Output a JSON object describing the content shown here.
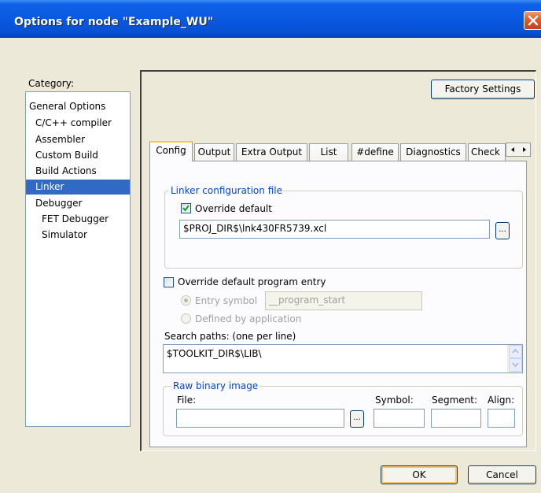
{
  "window": {
    "title": "Options for node \"Example_WU\""
  },
  "category": {
    "label": "Category:",
    "items": [
      {
        "label": "General Options"
      },
      {
        "label": "C/C++ compiler"
      },
      {
        "label": "Assembler"
      },
      {
        "label": "Custom Build"
      },
      {
        "label": "Build Actions"
      },
      {
        "label": "Linker"
      },
      {
        "label": "Debugger"
      },
      {
        "label": "FET Debugger"
      },
      {
        "label": "Simulator"
      }
    ],
    "selected": "Linker"
  },
  "factory_settings_label": "Factory Settings",
  "tabs": [
    {
      "label": "Config"
    },
    {
      "label": "Output"
    },
    {
      "label": "Extra Output"
    },
    {
      "label": "List"
    },
    {
      "label": "#define"
    },
    {
      "label": "Diagnostics"
    },
    {
      "label": "Check"
    }
  ],
  "active_tab": "Config",
  "linker_config": {
    "group_title": "Linker configuration file",
    "override_label": "Override default",
    "override_checked": true,
    "path_value": "$PROJ_DIR$\\lnk430FR5739.xcl",
    "browse_label": "..."
  },
  "program_entry": {
    "override_label": "Override default program entry",
    "override_checked": false,
    "entry_symbol_label": "Entry symbol",
    "entry_symbol_value": "__program_start",
    "defined_by_app_label": "Defined by application"
  },
  "search_paths": {
    "label": "Search paths:  (one per line)",
    "value": "$TOOLKIT_DIR$\\LIB\\"
  },
  "raw_binary": {
    "group_title": "Raw binary image",
    "file_label": "File:",
    "file_value": "",
    "browse_label": "...",
    "symbol_label": "Symbol:",
    "symbol_value": "",
    "segment_label": "Segment:",
    "segment_value": "",
    "align_label": "Align:",
    "align_value": ""
  },
  "buttons": {
    "ok": "OK",
    "cancel": "Cancel"
  },
  "colors": {
    "selection": "#316AC5",
    "title_bar": "#0A58E0",
    "group_title": "#0046D5"
  }
}
